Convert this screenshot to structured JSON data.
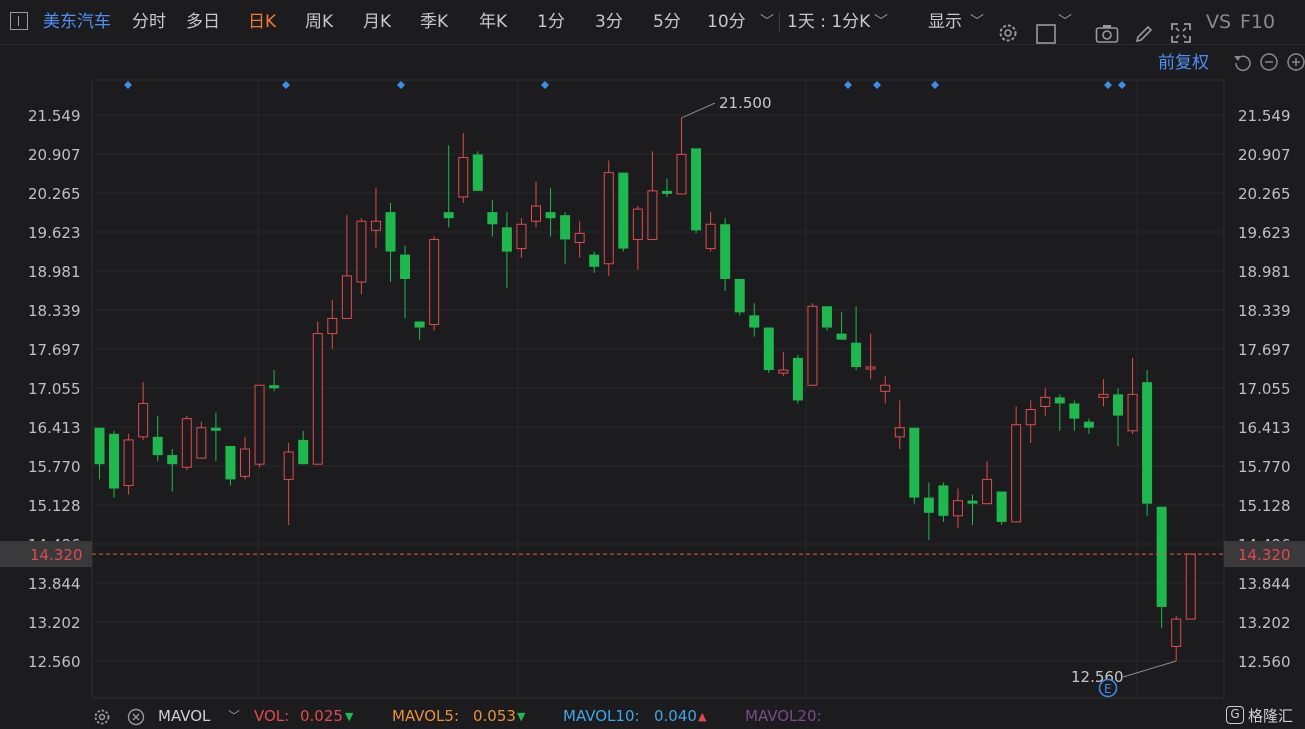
{
  "toolbar": {
    "symbol": "美东汽车",
    "periods": [
      "分时",
      "多日",
      "日K",
      "周K",
      "月K",
      "季K",
      "年K",
      "1分",
      "3分",
      "5分",
      "10分"
    ],
    "active_period": "日K",
    "range": "1天 : 1分K",
    "display": "显示",
    "vs": "VS",
    "f10": "F10"
  },
  "chart": {
    "adjust": "前复权",
    "price_ticks": [
      "21.549",
      "20.907",
      "20.265",
      "19.623",
      "18.981",
      "18.339",
      "17.697",
      "17.055",
      "16.413",
      "15.770",
      "15.128",
      "14.486",
      "13.844",
      "13.202",
      "12.560"
    ],
    "current_price": "14.320",
    "high_label": "21.500",
    "low_label": "12.560",
    "event_marker": "E",
    "colors": {
      "up": "#e04a4a",
      "down": "#1fb84e",
      "marker": "#3b8fe8",
      "current": "#e8583a"
    }
  },
  "chart_data": {
    "type": "candlestick",
    "ylim": [
      12.0,
      21.9
    ],
    "grid": true,
    "current_price": 14.32,
    "candles": [
      {
        "o": 16.4,
        "c": 15.8,
        "h": 16.4,
        "l": 15.55
      },
      {
        "o": 16.3,
        "c": 15.4,
        "h": 16.35,
        "l": 15.25
      },
      {
        "o": 15.45,
        "c": 16.2,
        "h": 16.3,
        "l": 15.3
      },
      {
        "o": 16.25,
        "c": 16.8,
        "h": 17.15,
        "l": 16.2
      },
      {
        "o": 16.25,
        "c": 15.95,
        "h": 16.6,
        "l": 15.85
      },
      {
        "o": 15.95,
        "c": 15.8,
        "h": 16.05,
        "l": 15.35
      },
      {
        "o": 15.75,
        "c": 16.55,
        "h": 16.6,
        "l": 15.7
      },
      {
        "o": 15.9,
        "c": 16.4,
        "h": 16.5,
        "l": 15.9
      },
      {
        "o": 16.4,
        "c": 16.35,
        "h": 16.65,
        "l": 15.85
      },
      {
        "o": 16.1,
        "c": 15.55,
        "h": 16.1,
        "l": 15.45
      },
      {
        "o": 15.6,
        "c": 16.05,
        "h": 16.25,
        "l": 15.55
      },
      {
        "o": 15.8,
        "c": 17.1,
        "h": 17.1,
        "l": 15.75
      },
      {
        "o": 17.1,
        "c": 17.05,
        "h": 17.35,
        "l": 17.0
      },
      {
        "o": 15.55,
        "c": 16.0,
        "h": 16.15,
        "l": 14.8
      },
      {
        "o": 16.2,
        "c": 15.8,
        "h": 16.35,
        "l": 15.8
      },
      {
        "o": 15.8,
        "c": 17.95,
        "h": 18.15,
        "l": 15.8
      },
      {
        "o": 17.95,
        "c": 18.2,
        "h": 18.5,
        "l": 17.7
      },
      {
        "o": 18.2,
        "c": 18.9,
        "h": 19.9,
        "l": 18.2
      },
      {
        "o": 18.8,
        "c": 19.8,
        "h": 19.85,
        "l": 18.6
      },
      {
        "o": 19.65,
        "c": 19.8,
        "h": 20.35,
        "l": 19.35
      },
      {
        "o": 19.95,
        "c": 19.3,
        "h": 20.1,
        "l": 18.8
      },
      {
        "o": 19.25,
        "c": 18.85,
        "h": 19.4,
        "l": 18.2
      },
      {
        "o": 18.15,
        "c": 18.05,
        "h": 18.15,
        "l": 17.85
      },
      {
        "o": 18.1,
        "c": 19.5,
        "h": 19.55,
        "l": 18.0
      },
      {
        "o": 19.95,
        "c": 19.85,
        "h": 21.05,
        "l": 19.7
      },
      {
        "o": 20.2,
        "c": 20.85,
        "h": 21.25,
        "l": 20.1
      },
      {
        "o": 20.9,
        "c": 20.3,
        "h": 20.95,
        "l": 20.3
      },
      {
        "o": 19.95,
        "c": 19.75,
        "h": 20.15,
        "l": 19.55
      },
      {
        "o": 19.7,
        "c": 19.3,
        "h": 19.95,
        "l": 18.7
      },
      {
        "o": 19.35,
        "c": 19.75,
        "h": 19.85,
        "l": 19.2
      },
      {
        "o": 19.8,
        "c": 20.05,
        "h": 20.45,
        "l": 19.7
      },
      {
        "o": 19.95,
        "c": 19.85,
        "h": 20.35,
        "l": 19.55
      },
      {
        "o": 19.9,
        "c": 19.5,
        "h": 19.95,
        "l": 19.1
      },
      {
        "o": 19.45,
        "c": 19.6,
        "h": 19.8,
        "l": 19.2
      },
      {
        "o": 19.25,
        "c": 19.05,
        "h": 19.3,
        "l": 18.95
      },
      {
        "o": 19.1,
        "c": 20.6,
        "h": 20.8,
        "l": 18.9
      },
      {
        "o": 20.6,
        "c": 19.35,
        "h": 20.6,
        "l": 19.3
      },
      {
        "o": 19.5,
        "c": 20.0,
        "h": 20.05,
        "l": 19.0
      },
      {
        "o": 19.5,
        "c": 20.3,
        "h": 20.95,
        "l": 19.5
      },
      {
        "o": 20.3,
        "c": 20.25,
        "h": 20.5,
        "l": 20.2
      },
      {
        "o": 20.25,
        "c": 20.9,
        "h": 21.5,
        "l": 20.25
      },
      {
        "o": 21.0,
        "c": 19.65,
        "h": 21.0,
        "l": 19.6
      },
      {
        "o": 19.35,
        "c": 19.75,
        "h": 19.95,
        "l": 19.3
      },
      {
        "o": 19.75,
        "c": 18.85,
        "h": 19.85,
        "l": 18.65
      },
      {
        "o": 18.85,
        "c": 18.3,
        "h": 18.85,
        "l": 18.25
      },
      {
        "o": 18.25,
        "c": 18.05,
        "h": 18.45,
        "l": 17.9
      },
      {
        "o": 18.05,
        "c": 17.35,
        "h": 18.05,
        "l": 17.3
      },
      {
        "o": 17.3,
        "c": 17.35,
        "h": 17.65,
        "l": 17.25
      },
      {
        "o": 17.55,
        "c": 16.85,
        "h": 17.6,
        "l": 16.8
      },
      {
        "o": 17.1,
        "c": 18.4,
        "h": 18.45,
        "l": 17.1
      },
      {
        "o": 18.4,
        "c": 18.05,
        "h": 18.4,
        "l": 18.0
      },
      {
        "o": 17.95,
        "c": 17.85,
        "h": 18.3,
        "l": 17.85
      },
      {
        "o": 17.8,
        "c": 17.4,
        "h": 18.4,
        "l": 17.35
      },
      {
        "o": 17.4,
        "c": 17.4,
        "h": 17.95,
        "l": 17.2
      },
      {
        "o": 17.0,
        "c": 17.1,
        "h": 17.25,
        "l": 16.8
      },
      {
        "o": 16.25,
        "c": 16.4,
        "h": 16.85,
        "l": 16.05
      },
      {
        "o": 16.4,
        "c": 15.25,
        "h": 16.4,
        "l": 15.15
      },
      {
        "o": 15.25,
        "c": 15.0,
        "h": 15.5,
        "l": 14.55
      },
      {
        "o": 15.45,
        "c": 14.95,
        "h": 15.5,
        "l": 14.85
      },
      {
        "o": 14.95,
        "c": 15.2,
        "h": 15.4,
        "l": 14.75
      },
      {
        "o": 15.2,
        "c": 15.15,
        "h": 15.3,
        "l": 14.8
      },
      {
        "o": 15.15,
        "c": 15.55,
        "h": 15.85,
        "l": 15.15
      },
      {
        "o": 15.35,
        "c": 14.85,
        "h": 15.35,
        "l": 14.8
      },
      {
        "o": 14.85,
        "c": 16.45,
        "h": 16.75,
        "l": 14.85
      },
      {
        "o": 16.45,
        "c": 16.7,
        "h": 16.85,
        "l": 16.15
      },
      {
        "o": 16.75,
        "c": 16.9,
        "h": 17.05,
        "l": 16.6
      },
      {
        "o": 16.9,
        "c": 16.8,
        "h": 16.95,
        "l": 16.35
      },
      {
        "o": 16.8,
        "c": 16.55,
        "h": 16.85,
        "l": 16.35
      },
      {
        "o": 16.5,
        "c": 16.4,
        "h": 16.55,
        "l": 16.3
      },
      {
        "o": 16.9,
        "c": 16.95,
        "h": 17.2,
        "l": 16.75
      },
      {
        "o": 16.95,
        "c": 16.6,
        "h": 17.05,
        "l": 16.1
      },
      {
        "o": 16.35,
        "c": 16.95,
        "h": 17.55,
        "l": 16.3
      },
      {
        "o": 17.15,
        "c": 15.15,
        "h": 17.35,
        "l": 14.95
      },
      {
        "o": 15.1,
        "c": 13.45,
        "h": 15.1,
        "l": 13.1
      },
      {
        "o": 12.8,
        "c": 13.25,
        "h": 13.3,
        "l": 12.56
      },
      {
        "o": 13.25,
        "c": 14.32,
        "h": 14.32,
        "l": 13.25
      }
    ],
    "volume_indicator": {
      "name": "MAVOL",
      "VOL": {
        "label": "VOL:",
        "value": "0.025",
        "trend": "down"
      },
      "MAVOL5": {
        "label": "MAVOL5:",
        "value": "0.053",
        "trend": "down"
      },
      "MAVOL10": {
        "label": "MAVOL10:",
        "value": "0.040",
        "trend": "up"
      },
      "MAVOL20": {
        "label": "MAVOL20:",
        "value": ""
      }
    }
  },
  "watermark": "格隆汇"
}
